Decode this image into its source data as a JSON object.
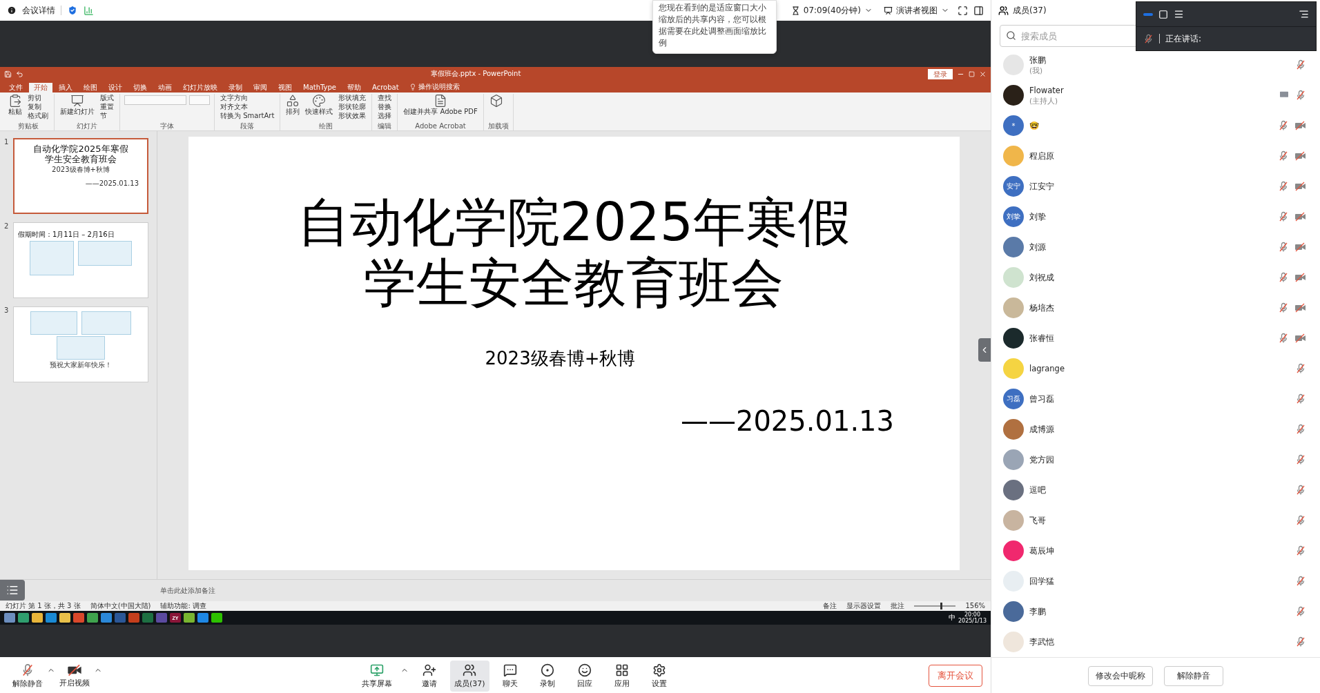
{
  "top_bar": {
    "meeting_info": "会议详情",
    "timer": "07:09(40分钟)",
    "view_mode": "演讲者视图"
  },
  "tooltip": "您现在看到的是适应窗口大小缩放后的共享内容，您可以根据需要在此处调整画面缩放比例",
  "shared_screen": {
    "title": "寒假班会.pptx - PowerPoint",
    "signin": "登录",
    "tabs": [
      {
        "label": "文件",
        "selected": false
      },
      {
        "label": "开始",
        "selected": true
      },
      {
        "label": "插入",
        "selected": false
      },
      {
        "label": "绘图",
        "selected": false
      },
      {
        "label": "设计",
        "selected": false
      },
      {
        "label": "切换",
        "selected": false
      },
      {
        "label": "动画",
        "selected": false
      },
      {
        "label": "幻灯片放映",
        "selected": false
      },
      {
        "label": "录制",
        "selected": false
      },
      {
        "label": "审阅",
        "selected": false
      },
      {
        "label": "视图",
        "selected": false
      },
      {
        "label": "MathType",
        "selected": false
      },
      {
        "label": "帮助",
        "selected": false
      },
      {
        "label": "Acrobat",
        "selected": false
      }
    ],
    "tell_me": "操作说明搜索",
    "ribbon_groups": [
      {
        "label": "剪贴板",
        "commands": [
          {
            "kind": "large",
            "label": "粘贴"
          },
          {
            "kind": "small",
            "label": "剪切"
          },
          {
            "kind": "small",
            "label": "复制"
          },
          {
            "kind": "small",
            "label": "格式刷"
          }
        ]
      },
      {
        "label": "幻灯片",
        "commands": [
          {
            "kind": "large",
            "label": "新建幻灯片"
          },
          {
            "kind": "small",
            "label": "版式"
          },
          {
            "kind": "small",
            "label": "重置"
          },
          {
            "kind": "small",
            "label": "节"
          }
        ]
      },
      {
        "label": "字体",
        "commands": [
          {
            "kind": "field"
          },
          {
            "kind": "field"
          }
        ]
      },
      {
        "label": "段落",
        "commands": [
          {
            "kind": "small",
            "label": "文字方向"
          },
          {
            "kind": "small",
            "label": "对齐文本"
          },
          {
            "kind": "small",
            "label": "转换为 SmartArt"
          }
        ]
      },
      {
        "label": "绘图",
        "commands": [
          {
            "kind": "large",
            "label": "排列"
          },
          {
            "kind": "large",
            "label": "快速样式"
          },
          {
            "kind": "small",
            "label": "形状填充"
          },
          {
            "kind": "small",
            "label": "形状轮廓"
          },
          {
            "kind": "small",
            "label": "形状效果"
          }
        ]
      },
      {
        "label": "编辑",
        "commands": [
          {
            "kind": "small",
            "label": "查找"
          },
          {
            "kind": "small",
            "label": "替换"
          },
          {
            "kind": "small",
            "label": "选择"
          }
        ]
      },
      {
        "label": "Adobe Acrobat",
        "commands": [
          {
            "kind": "large",
            "label": "创建并共享 Adobe PDF"
          }
        ]
      },
      {
        "label": "加载项",
        "commands": [
          {
            "kind": "large"
          }
        ]
      }
    ],
    "slides": [
      {
        "number": "1",
        "kind": "title",
        "selected": true,
        "title_lines": [
          "自动化学院2025年寒假",
          "学生安全教育班会"
        ],
        "subtitle": "2023级春博+秋博",
        "date": "——2025.01.13"
      },
      {
        "number": "2",
        "kind": "docs",
        "selected": false,
        "heading": "假期时间：1月11日 – 2月16日"
      },
      {
        "number": "3",
        "kind": "closing",
        "selected": false,
        "footer": "预祝大家新年快乐！"
      }
    ],
    "current_slide": {
      "title_lines": [
        "自动化学院2025年寒假",
        "学生安全教育班会"
      ],
      "subtitle": "2023级春博+秋博",
      "date": "——2025.01.13"
    },
    "notes_placeholder": "单击此处添加备注",
    "status_bar": {
      "slide_count": "幻灯片 第 1 张，共 3 张",
      "language": "简体中文(中国大陆)",
      "accessibility": "辅助功能: 调查",
      "notes": "备注",
      "display": "显示器设置",
      "comments": "批注",
      "zoom": "156%",
      "zoom_level": {
        "level": 0.62
      }
    },
    "taskbar": {
      "apps": [
        {
          "color": "#6c8ebf"
        },
        {
          "color": "#2f9e6e"
        },
        {
          "color": "#e8b53a"
        },
        {
          "color": "#1a8ad4"
        },
        {
          "color": "#e8c04a"
        },
        {
          "color": "#d9482b"
        },
        {
          "color": "#3fa34d"
        },
        {
          "color": "#2b88d8"
        },
        {
          "color": "#2b5797"
        },
        {
          "color": "#c43e1c"
        },
        {
          "color": "#1d6f42"
        },
        {
          "color": "#5b4aa0"
        },
        {
          "color": "#8a1538",
          "label": "ZY"
        },
        {
          "color": "#79b530"
        },
        {
          "color": "#1e88e5"
        },
        {
          "color": "#2dc100"
        }
      ],
      "ime": "中",
      "time": "20:00",
      "date": "2025/1/13"
    }
  },
  "speaking": {
    "label": "正在讲话:"
  },
  "members_panel": {
    "title": "成员(37)",
    "search_placeholder": "搜索成员",
    "members": [
      {
        "name": "张鹏",
        "role": "(我)",
        "avatar": {
          "kind": "photo",
          "color": "#e6e6e6"
        },
        "sharing": false,
        "mic_muted": true,
        "camera_off": false
      },
      {
        "name": "Flowater",
        "role": "(主持人)",
        "avatar": {
          "kind": "photo",
          "color": "#2a2118"
        },
        "sharing": true,
        "mic_muted": true,
        "camera_off": false
      },
      {
        "name": "🤓",
        "avatar": {
          "kind": "initials",
          "color": "#3e6fc1",
          "text": "*"
        },
        "sharing": false,
        "mic_muted": true,
        "camera_off": true
      },
      {
        "name": "程启原",
        "avatar": {
          "kind": "photo",
          "color": "#f0b64a"
        },
        "sharing": false,
        "mic_muted": true,
        "camera_off": true
      },
      {
        "name": "江安宁",
        "avatar": {
          "kind": "initials",
          "color": "#3e6fc1",
          "text": "安宁"
        },
        "sharing": false,
        "mic_muted": true,
        "camera_off": true
      },
      {
        "name": "刘挚",
        "avatar": {
          "kind": "initials",
          "color": "#3e6fc1",
          "text": "刘挚"
        },
        "sharing": false,
        "mic_muted": true,
        "camera_off": true
      },
      {
        "name": "刘源",
        "avatar": {
          "kind": "photo",
          "color": "#5a7aa8"
        },
        "sharing": false,
        "mic_muted": true,
        "camera_off": true
      },
      {
        "name": "刘祝成",
        "avatar": {
          "kind": "photo",
          "color": "#cfe3cf"
        },
        "sharing": false,
        "mic_muted": true,
        "camera_off": true
      },
      {
        "name": "杨培杰",
        "avatar": {
          "kind": "photo",
          "color": "#c9b89a"
        },
        "sharing": false,
        "mic_muted": true,
        "camera_off": true
      },
      {
        "name": "张睿恒",
        "avatar": {
          "kind": "photo",
          "color": "#1b2a2c"
        },
        "sharing": false,
        "mic_muted": true,
        "camera_off": true
      },
      {
        "name": "lagrange",
        "avatar": {
          "kind": "photo",
          "color": "#f5d442"
        },
        "sharing": false,
        "mic_muted": true,
        "camera_off": false
      },
      {
        "name": "曾习磊",
        "avatar": {
          "kind": "initials",
          "color": "#3e6fc1",
          "text": "习磊"
        },
        "sharing": false,
        "mic_muted": true,
        "camera_off": false
      },
      {
        "name": "成博源",
        "avatar": {
          "kind": "photo",
          "color": "#b07040"
        },
        "sharing": false,
        "mic_muted": true,
        "camera_off": false
      },
      {
        "name": "党方园",
        "avatar": {
          "kind": "photo",
          "color": "#9aa5b5"
        },
        "sharing": false,
        "mic_muted": true,
        "camera_off": false
      },
      {
        "name": "逗吧",
        "avatar": {
          "kind": "photo",
          "color": "#6a7080"
        },
        "sharing": false,
        "mic_muted": true,
        "camera_off": false
      },
      {
        "name": "飞哥",
        "avatar": {
          "kind": "photo",
          "color": "#c8b4a0"
        },
        "sharing": false,
        "mic_muted": true,
        "camera_off": false
      },
      {
        "name": "葛辰坤",
        "avatar": {
          "kind": "photo",
          "color": "#f0286e"
        },
        "sharing": false,
        "mic_muted": true,
        "camera_off": false
      },
      {
        "name": "回学猛",
        "avatar": {
          "kind": "photo",
          "color": "#e8eef2"
        },
        "sharing": false,
        "mic_muted": true,
        "camera_off": false
      },
      {
        "name": "李鹏",
        "avatar": {
          "kind": "photo",
          "color": "#4a6a9a"
        },
        "sharing": false,
        "mic_muted": true,
        "camera_off": false
      },
      {
        "name": "李武恺",
        "avatar": {
          "kind": "photo",
          "color": "#efe6dc"
        },
        "sharing": false,
        "mic_muted": true,
        "camera_off": false
      }
    ],
    "buttons": [
      "修改会中昵称",
      "解除静音"
    ]
  },
  "toolbar": {
    "left": [
      {
        "kind": "mic",
        "label": "解除静音",
        "off": true
      },
      {
        "kind": "video",
        "label": "开启视频",
        "off": true
      }
    ],
    "center": [
      {
        "kind": "share",
        "label": "共享屏幕",
        "selected": false,
        "caret": true
      },
      {
        "kind": "invite",
        "label": "邀请",
        "selected": false,
        "caret": false
      },
      {
        "kind": "members",
        "label": "成员(37)",
        "selected": true,
        "caret": false
      },
      {
        "kind": "chat",
        "label": "聊天",
        "selected": false,
        "caret": false
      },
      {
        "kind": "record",
        "label": "录制",
        "selected": false,
        "caret": false
      },
      {
        "kind": "react",
        "label": "回应",
        "selected": false,
        "caret": false
      },
      {
        "kind": "apps",
        "label": "应用",
        "selected": false,
        "caret": false
      },
      {
        "kind": "settings",
        "label": "设置",
        "selected": false,
        "caret": false
      }
    ],
    "leave": "离开会议"
  }
}
